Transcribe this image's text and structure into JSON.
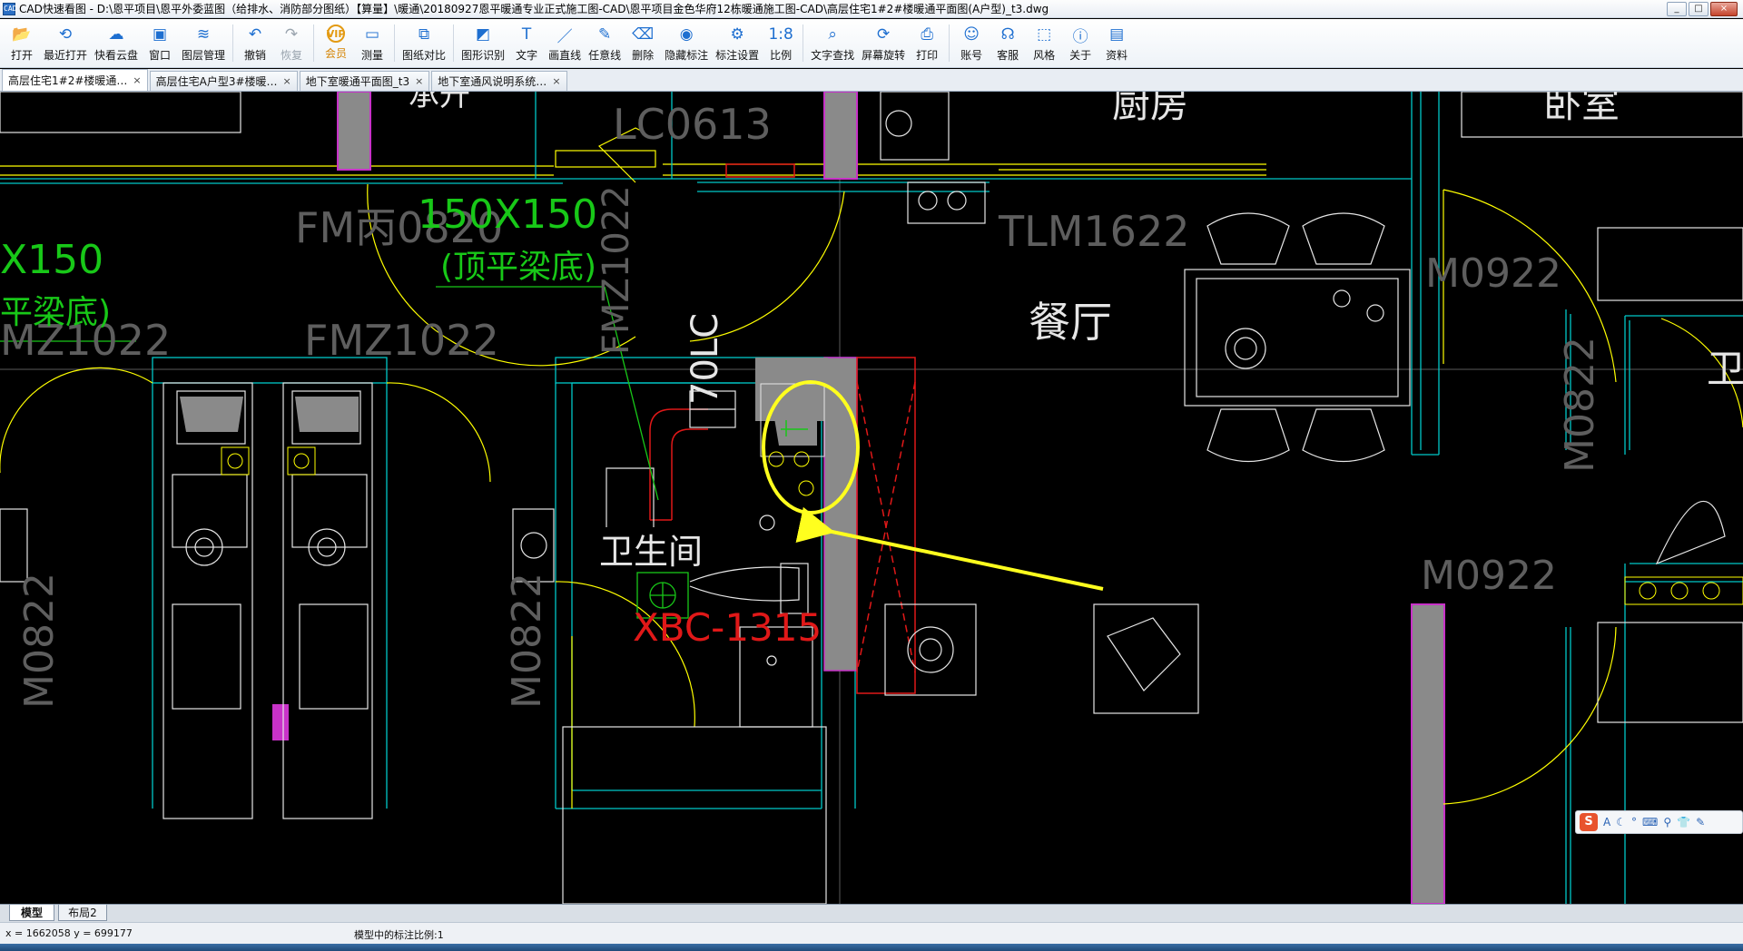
{
  "window": {
    "title": "CAD快速看图 - D:\\恩平项目\\恩平外委蓝图（给排水、消防部分图纸）【算量】\\暖通\\20180927恩平暖通专业正式施工图-CAD\\恩平项目金色华府12栋暖通施工图-CAD\\高层住宅1#2#楼暖通平面图(A户型)_t3.dwg",
    "icon_label": "CAD",
    "minimize": "_",
    "maximize": "□",
    "close": "×"
  },
  "toolbar": {
    "items": [
      {
        "key": "open",
        "label": "打开",
        "icon": "folder-open-icon",
        "glyph": "📂"
      },
      {
        "key": "recent",
        "label": "最近打开",
        "icon": "history-clock-icon",
        "glyph": "⟲"
      },
      {
        "key": "cloud",
        "label": "快看云盘",
        "icon": "cloud-icon",
        "glyph": "☁"
      },
      {
        "key": "window",
        "label": "窗口",
        "icon": "window-icon",
        "glyph": "▣"
      },
      {
        "key": "layers",
        "label": "图层管理",
        "icon": "layers-icon",
        "glyph": "≋"
      },
      {
        "key": "undo",
        "label": "撤销",
        "icon": "undo-icon",
        "glyph": "↶"
      },
      {
        "key": "redo",
        "label": "恢复",
        "icon": "redo-icon",
        "glyph": "↷"
      },
      {
        "key": "vip",
        "label": "会员",
        "icon": "vip-badge-icon",
        "glyph": "VIP"
      },
      {
        "key": "measure",
        "label": "测量",
        "icon": "ruler-icon",
        "glyph": "▭"
      },
      {
        "key": "compare",
        "label": "图纸对比",
        "icon": "compare-icon",
        "glyph": "⧉"
      },
      {
        "key": "recognize",
        "label": "图形识别",
        "icon": "shape-recognize-icon",
        "glyph": "◩"
      },
      {
        "key": "text",
        "label": "文字",
        "icon": "text-T-icon",
        "glyph": "T"
      },
      {
        "key": "line",
        "label": "画直线",
        "icon": "line-draw-icon",
        "glyph": "／"
      },
      {
        "key": "freeline",
        "label": "任意线",
        "icon": "pen-icon",
        "glyph": "✎"
      },
      {
        "key": "delete",
        "label": "删除",
        "icon": "eraser-icon",
        "glyph": "⌫"
      },
      {
        "key": "hide_marks",
        "label": "隐藏标注",
        "icon": "eye-hide-icon",
        "glyph": "◉"
      },
      {
        "key": "mark_settings",
        "label": "标注设置",
        "icon": "mark-settings-icon",
        "glyph": "⚙"
      },
      {
        "key": "ratio",
        "label": "比例",
        "icon": "scale-ratio-icon",
        "glyph": "1:8"
      },
      {
        "key": "text_search",
        "label": "文字查找",
        "icon": "text-search-icon",
        "glyph": "⌕"
      },
      {
        "key": "rotate",
        "label": "屏幕旋转",
        "icon": "rotate-screen-icon",
        "glyph": "⟳"
      },
      {
        "key": "print",
        "label": "打印",
        "icon": "printer-icon",
        "glyph": "⎙"
      },
      {
        "key": "account",
        "label": "账号",
        "icon": "user-icon",
        "glyph": "☺"
      },
      {
        "key": "support",
        "label": "客服",
        "icon": "headset-icon",
        "glyph": "☊"
      },
      {
        "key": "style",
        "label": "风格",
        "icon": "style-icon",
        "glyph": "⬚"
      },
      {
        "key": "about",
        "label": "关于",
        "icon": "info-icon",
        "glyph": "ⓘ"
      },
      {
        "key": "resources",
        "label": "资料",
        "icon": "resources-icon",
        "glyph": "▤"
      }
    ]
  },
  "tabs": [
    {
      "label": "高层住宅1#2#楼暖通…",
      "active": true
    },
    {
      "label": "高层住宅A户型3#楼暖…",
      "active": false
    },
    {
      "label": "地下室暖通平面图_t3",
      "active": false
    },
    {
      "label": "地下室通风说明系统…",
      "active": false
    }
  ],
  "tab_close": "×",
  "drawing": {
    "labels": {
      "kitchen": "厨房",
      "bedroom": "卧室",
      "dining": "餐厅",
      "bathroom": "卫生间",
      "bath_right": "卫",
      "lc0613": "LC0613",
      "tlm1622": "TLM1622",
      "m0922_top": "M0922",
      "m0922_bottom": "M0922",
      "m0822_right": "M0822",
      "m0822_left": "M0822",
      "m0822_mid": "M0822",
      "fm0820": "FM丙0820",
      "fmz1022_mid": "FMZ1022",
      "fmz1022_left": "MZ1022",
      "fmz1022_vert": "FMZ1022",
      "duct_size_main": "150X150",
      "duct_size_left": "X150",
      "beam_note_main": "(顶平梁底)",
      "beam_note_left": "平梁底)",
      "fan_tag": "XBC-1315",
      "shaft_tag": "70LC",
      "partial_top": "承升"
    }
  },
  "layout_tabs": [
    {
      "label": "模型",
      "active": true
    },
    {
      "label": "布局2",
      "active": false
    }
  ],
  "status": {
    "coords": "x = 1662058  y = 699177",
    "scale_text": "模型中的标注比例:1"
  },
  "ime": {
    "logo": "S",
    "items": [
      "A",
      "☾",
      "°",
      "⌨",
      "⚲",
      "👕",
      "✎"
    ]
  },
  "colors": {
    "cyan": "#00c8c8",
    "yellow": "#ffff00",
    "white": "#e6e6e6",
    "green": "#18c818",
    "red": "#e01818",
    "magenta": "#c832c8",
    "gray_fill": "#8a8a8a",
    "annotation_yellow": "#ffff1e"
  }
}
